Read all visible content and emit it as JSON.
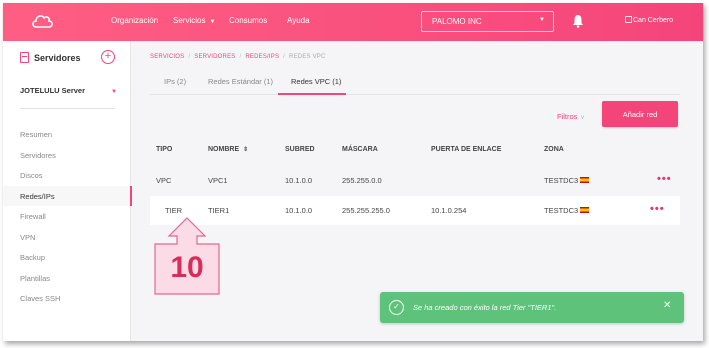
{
  "header": {
    "nav": [
      {
        "label": "Organización",
        "caret": false
      },
      {
        "label": "Servicios",
        "caret": true
      },
      {
        "label": "Consumos",
        "caret": false
      },
      {
        "label": "Ayuda",
        "caret": false
      }
    ],
    "company": "PALOMO INC",
    "user_image_alt": "Can Cerbero"
  },
  "sidebar": {
    "title": "Servidores",
    "add_symbol": "+",
    "server": "JOTELULU Server",
    "items": [
      {
        "label": "Resumen",
        "active": false
      },
      {
        "label": "Servidores",
        "active": false
      },
      {
        "label": "Discos",
        "active": false
      },
      {
        "label": "Redes/IPs",
        "active": true
      },
      {
        "label": "Firewall",
        "active": false
      },
      {
        "label": "VPN",
        "active": false
      },
      {
        "label": "Backup",
        "active": false
      },
      {
        "label": "Plantillas",
        "active": false
      },
      {
        "label": "Claves SSH",
        "active": false
      }
    ]
  },
  "breadcrumb": [
    "SERVICIOS",
    "SERVIDORES",
    "REDES/IPS",
    "REDES VPC"
  ],
  "tabs": [
    {
      "label": "IPs (2)",
      "active": false
    },
    {
      "label": "Redes Estándar (1)",
      "active": false
    },
    {
      "label": "Redes VPC (1)",
      "active": true
    }
  ],
  "toolbar": {
    "filters_label": "Filtros",
    "add_button": "Añadir red"
  },
  "table": {
    "headers": [
      "TIPO",
      "NOMBRE",
      "SUBRED",
      "MÁSCARA",
      "PUERTA DE ENLACE",
      "ZONA"
    ],
    "rows": [
      {
        "tipo": "VPC",
        "nombre": "VPC1",
        "subred": "10.1.0.0",
        "mascara": "255.255.0.0",
        "puerta": "",
        "zona": "TESTDC3"
      },
      {
        "tipo": "TIER",
        "nombre": "TIER1",
        "subred": "10.1.0.0",
        "mascara": "255.255.255.0",
        "puerta": "10.1.0.254",
        "zona": "TESTDC3"
      }
    ],
    "more_symbol": "•••"
  },
  "callout": {
    "number": "10"
  },
  "toast": {
    "message": "Se ha creado con éxito la red Tier \"TIER1\".",
    "close": "✕"
  },
  "colors": {
    "brand": "#f4457a",
    "success": "#5fc27a",
    "callout": "#d32f5a"
  }
}
